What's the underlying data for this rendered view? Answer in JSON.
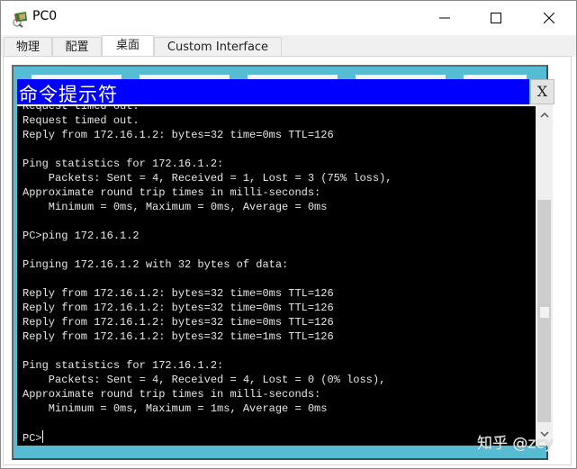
{
  "window": {
    "title": "PC0",
    "icon": "pc-device-icon",
    "controls": {
      "minimize": "minimize-icon",
      "maximize": "maximize-icon",
      "close": "close-icon"
    }
  },
  "tabs": [
    {
      "label": "物理",
      "active": false
    },
    {
      "label": "配置",
      "active": false
    },
    {
      "label": "桌面",
      "active": true
    },
    {
      "label": "Custom Interface",
      "active": false
    }
  ],
  "command_prompt": {
    "title": "命令提示符",
    "close_label": "X",
    "lines": [
      "Request timed out.",
      "Request timed out.",
      "Reply from 172.16.1.2: bytes=32 time=0ms TTL=126",
      "",
      "Ping statistics for 172.16.1.2:",
      "    Packets: Sent = 4, Received = 1, Lost = 3 (75% loss),",
      "Approximate round trip times in milli-seconds:",
      "    Minimum = 0ms, Maximum = 0ms, Average = 0ms",
      "",
      "PC>ping 172.16.1.2",
      "",
      "Pinging 172.16.1.2 with 32 bytes of data:",
      "",
      "Reply from 172.16.1.2: bytes=32 time=0ms TTL=126",
      "Reply from 172.16.1.2: bytes=32 time=0ms TTL=126",
      "Reply from 172.16.1.2: bytes=32 time=0ms TTL=126",
      "Reply from 172.16.1.2: bytes=32 time=1ms TTL=126",
      "",
      "Ping statistics for 172.16.1.2:",
      "    Packets: Sent = 4, Received = 4, Lost = 0 (0% loss),",
      "Approximate round trip times in milli-seconds:",
      "    Minimum = 0ms, Maximum = 1ms, Average = 0ms",
      "",
      "PC>"
    ],
    "scroll_position": 0.95
  },
  "watermark": "知乎 @zcy",
  "colors": {
    "cmd_header": "#0000ff",
    "terminal_bg": "#000000",
    "terminal_text": "#e8e8e8",
    "desktop_bg": "#55bcd3"
  }
}
